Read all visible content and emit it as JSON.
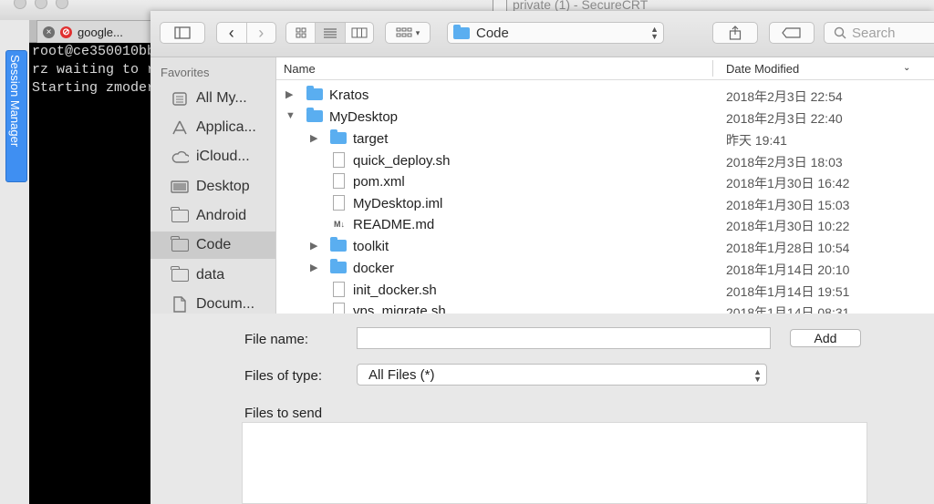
{
  "crt": {
    "window_title": "private (1) - SecureCRT",
    "session_manager_label": "Session Manager",
    "tab": {
      "title": "google..."
    },
    "terminal_lines": [
      "root@ce350010bb",
      "rz waiting to r",
      "Starting zmoder"
    ]
  },
  "dialog": {
    "toolbar": {
      "current_folder": "Code",
      "search_placeholder": "Search"
    },
    "sidebar": {
      "heading": "Favorites",
      "items": [
        {
          "label": "All My...",
          "icon": "all-files-icon"
        },
        {
          "label": "Applica...",
          "icon": "applications-icon"
        },
        {
          "label": "iCloud...",
          "icon": "cloud-icon"
        },
        {
          "label": "Desktop",
          "icon": "desktop-icon"
        },
        {
          "label": "Android",
          "icon": "folder-icon"
        },
        {
          "label": "Code",
          "icon": "folder-icon",
          "selected": true
        },
        {
          "label": "data",
          "icon": "folder-icon"
        },
        {
          "label": "Docum...",
          "icon": "documents-icon"
        }
      ]
    },
    "file_list": {
      "columns": {
        "name": "Name",
        "date": "Date Modified"
      },
      "rows": [
        {
          "name": "Kratos",
          "date": "2018年2月3日 22:54",
          "kind": "folder",
          "expanded": false,
          "depth": 0
        },
        {
          "name": "MyDesktop",
          "date": "2018年2月3日 22:40",
          "kind": "folder",
          "expanded": true,
          "depth": 0
        },
        {
          "name": "target",
          "date": "昨天 19:41",
          "kind": "folder",
          "expanded": false,
          "depth": 1
        },
        {
          "name": "quick_deploy.sh",
          "date": "2018年2月3日 18:03",
          "kind": "file",
          "depth": 1
        },
        {
          "name": "pom.xml",
          "date": "2018年1月30日 16:42",
          "kind": "file",
          "depth": 1
        },
        {
          "name": "MyDesktop.iml",
          "date": "2018年1月30日 15:03",
          "kind": "file",
          "depth": 1
        },
        {
          "name": "README.md",
          "date": "2018年1月30日 10:22",
          "kind": "md",
          "depth": 1
        },
        {
          "name": "toolkit",
          "date": "2018年1月28日 10:54",
          "kind": "folder",
          "expanded": false,
          "depth": 1
        },
        {
          "name": "docker",
          "date": "2018年1月14日 20:10",
          "kind": "folder",
          "expanded": false,
          "depth": 1
        },
        {
          "name": "init_docker.sh",
          "date": "2018年1月14日 19:51",
          "kind": "file",
          "depth": 1
        },
        {
          "name": "vps_migrate.sh",
          "date": "2018年1月14日 08:31",
          "kind": "file",
          "depth": 1
        }
      ]
    },
    "accessory": {
      "file_name_label": "File name:",
      "file_name_value": "",
      "add_label": "Add",
      "files_of_type_label": "Files of type:",
      "files_of_type_value": "All Files (*)",
      "files_to_send_label": "Files to send"
    }
  }
}
